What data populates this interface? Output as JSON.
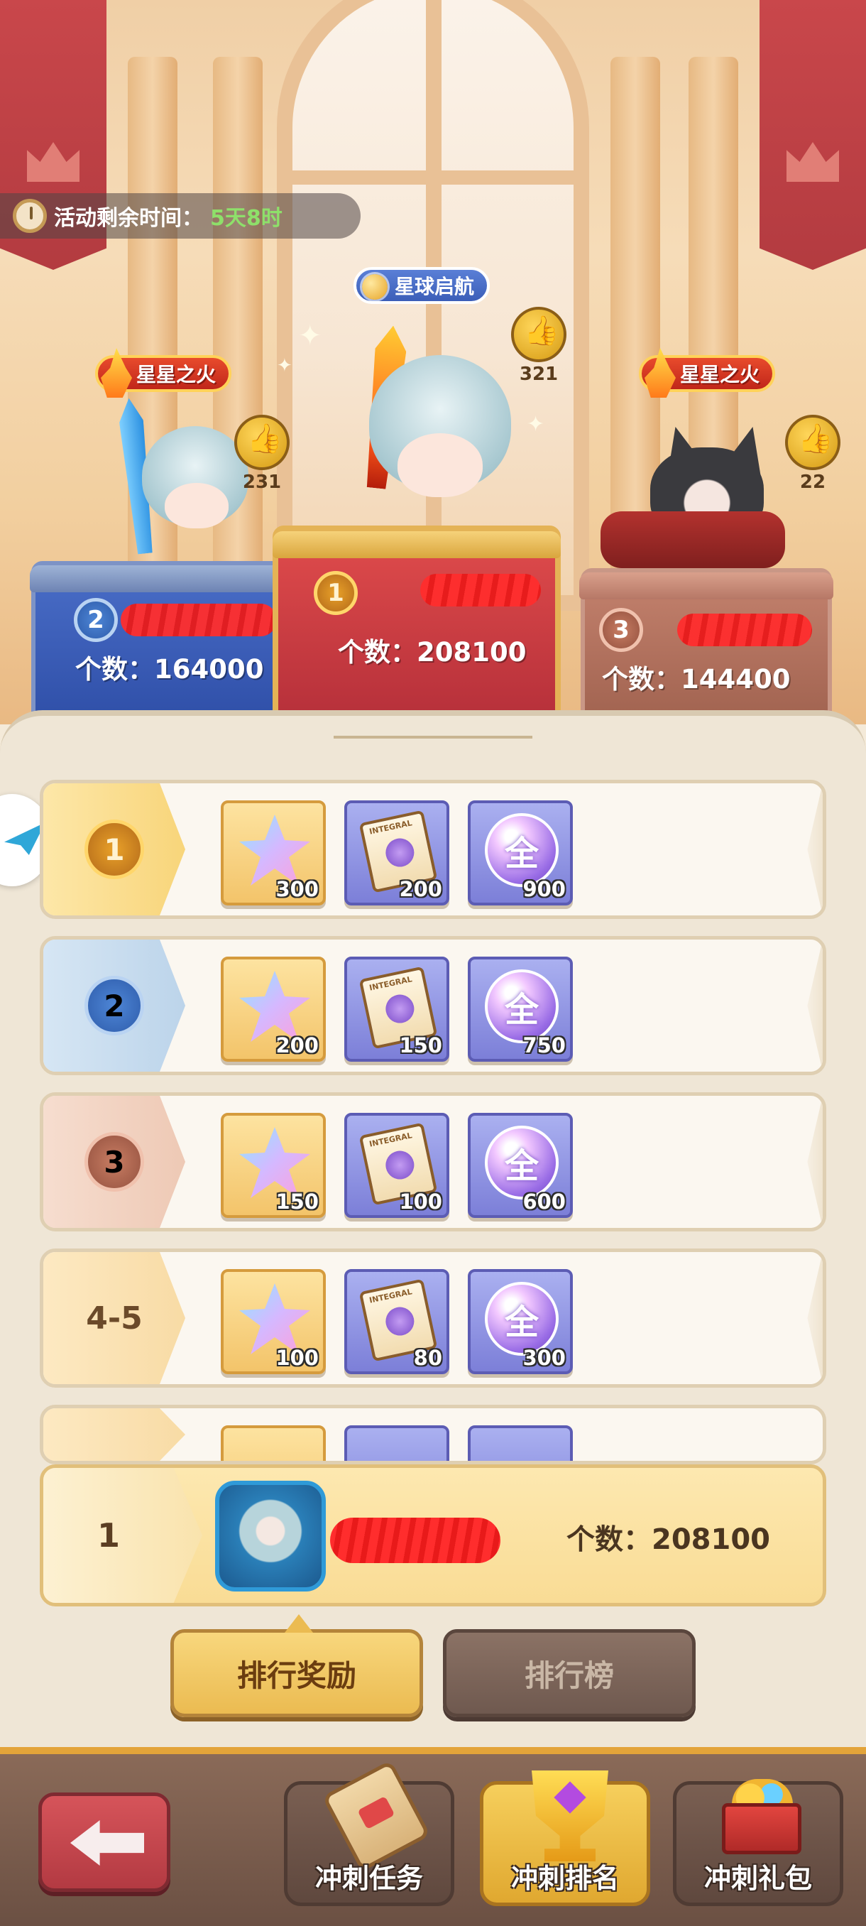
{
  "timer": {
    "label": "活动剩余时间：",
    "value": "5天8时"
  },
  "podium": {
    "first": {
      "title": "星球启航",
      "likes": "321",
      "rank": "1",
      "count": "个数：208100"
    },
    "second": {
      "title": "星星之火",
      "likes": "231",
      "rank": "2",
      "count": "个数：164000"
    },
    "third": {
      "title": "星星之火",
      "likes": "22",
      "rank": "3",
      "count": "个数：144400"
    }
  },
  "reward_rows": [
    {
      "rank": "1",
      "items": [
        {
          "icon": "star-shard-icon",
          "qty": "300"
        },
        {
          "icon": "integral-scroll-icon",
          "qty": "200",
          "mini": "INTEGRAL"
        },
        {
          "icon": "all-orb-icon",
          "glyph": "全",
          "qty": "900"
        }
      ]
    },
    {
      "rank": "2",
      "items": [
        {
          "icon": "star-shard-icon",
          "qty": "200"
        },
        {
          "icon": "integral-scroll-icon",
          "qty": "150",
          "mini": "INTEGRAL"
        },
        {
          "icon": "all-orb-icon",
          "glyph": "全",
          "qty": "750"
        }
      ]
    },
    {
      "rank": "3",
      "items": [
        {
          "icon": "star-shard-icon",
          "qty": "150"
        },
        {
          "icon": "integral-scroll-icon",
          "qty": "100",
          "mini": "INTEGRAL"
        },
        {
          "icon": "all-orb-icon",
          "glyph": "全",
          "qty": "600"
        }
      ]
    },
    {
      "rank": "4-5",
      "items": [
        {
          "icon": "star-shard-icon",
          "qty": "100"
        },
        {
          "icon": "integral-scroll-icon",
          "qty": "80",
          "mini": "INTEGRAL"
        },
        {
          "icon": "all-orb-icon",
          "glyph": "全",
          "qty": "300"
        }
      ]
    }
  ],
  "self_rank": {
    "rank": "1",
    "count": "个数：208100"
  },
  "tabs": {
    "rewards": "排行奖励",
    "leaderboard": "排行榜"
  },
  "bottom_nav": {
    "items": [
      {
        "label": "冲刺任务",
        "icon": "scroll-icon"
      },
      {
        "label": "冲刺排名",
        "icon": "trophy-icon"
      },
      {
        "label": "冲刺礼包",
        "icon": "gift-icon"
      }
    ]
  },
  "colors": {
    "accent_gold": "#ebbb51",
    "timer_value": "#8ee06a",
    "podium_first": "#e04c4c",
    "podium_second": "#4a6ec8",
    "podium_third": "#c4826e"
  }
}
